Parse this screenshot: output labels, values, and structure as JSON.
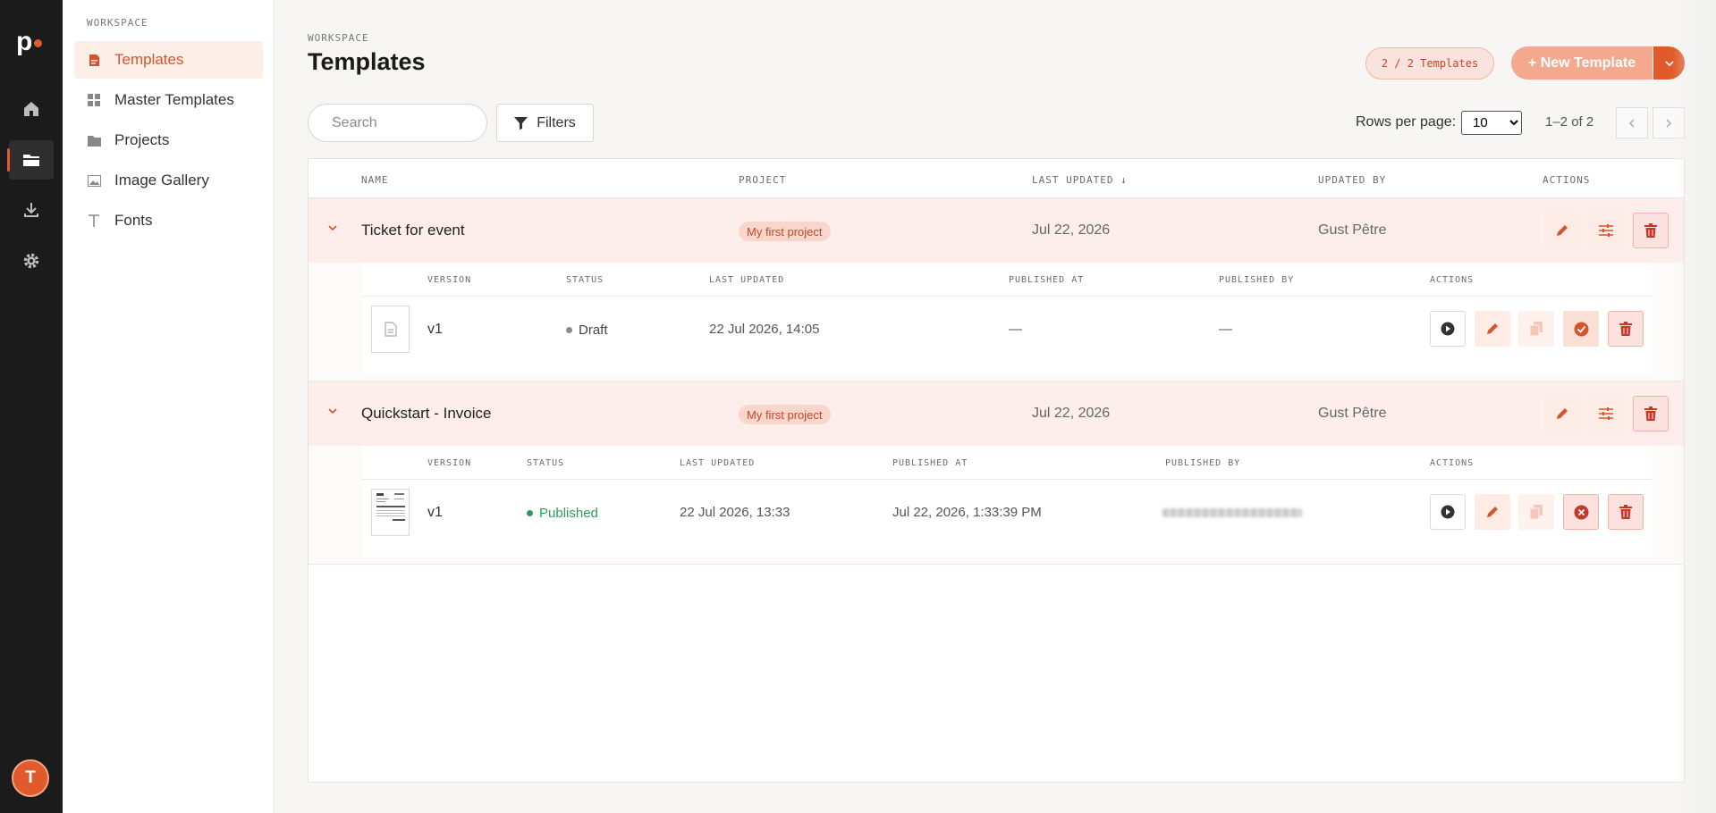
{
  "app": {
    "logo_text": "p",
    "user_initial": "T",
    "brand_color": "#e05a2b"
  },
  "rail": {
    "items": [
      {
        "icon": "home-icon"
      },
      {
        "icon": "folder-icon",
        "active": true
      },
      {
        "icon": "download-icon"
      },
      {
        "icon": "gear-icon"
      }
    ]
  },
  "sidebar": {
    "section_label": "WORKSPACE",
    "items": [
      {
        "label": "Templates",
        "icon": "template-icon",
        "active": true
      },
      {
        "label": "Master Templates",
        "icon": "grid-icon"
      },
      {
        "label": "Projects",
        "icon": "folder-icon"
      },
      {
        "label": "Image Gallery",
        "icon": "image-icon"
      },
      {
        "label": "Fonts",
        "icon": "type-icon"
      }
    ]
  },
  "header": {
    "breadcrumb": "WORKSPACE",
    "title": "Templates",
    "count_badge": "2 / 2 Templates",
    "new_button": "+ New Template"
  },
  "toolbar": {
    "search_placeholder": "Search",
    "filters_label": "Filters",
    "rows_per_page_label": "Rows per page:",
    "rows_per_page_value": "10",
    "rows_per_page_options": [
      "10"
    ],
    "range_text": "1–2 of 2"
  },
  "table": {
    "columns": [
      "NAME",
      "PROJECT",
      "LAST UPDATED ↓",
      "UPDATED BY",
      "ACTIONS"
    ],
    "rows": [
      {
        "name": "Ticket for event",
        "project": "My first project",
        "last_updated": "Jul 22, 2026",
        "updated_by": "Gust Pêtre",
        "versions_columns": [
          "VERSION",
          "STATUS",
          "LAST UPDATED",
          "PUBLISHED AT",
          "PUBLISHED BY",
          "ACTIONS"
        ],
        "versions": [
          {
            "version": "v1",
            "status": "Draft",
            "status_color": "#8a8a8a",
            "last_updated": "22 Jul 2026, 14:05",
            "published_at": "—",
            "published_by": "—"
          }
        ]
      },
      {
        "name": "Quickstart - Invoice",
        "project": "My first project",
        "last_updated": "Jul 22, 2026",
        "updated_by": "Gust Pêtre",
        "versions_columns": [
          "VERSION",
          "STATUS",
          "LAST UPDATED",
          "PUBLISHED AT",
          "PUBLISHED BY",
          "ACTIONS"
        ],
        "versions": [
          {
            "version": "v1",
            "status": "Published",
            "status_color": "#2e9d5a",
            "last_updated": "22 Jul 2026, 13:33",
            "published_at": "Jul 22, 2026, 1:33:39 PM",
            "published_by": ""
          }
        ]
      }
    ]
  }
}
